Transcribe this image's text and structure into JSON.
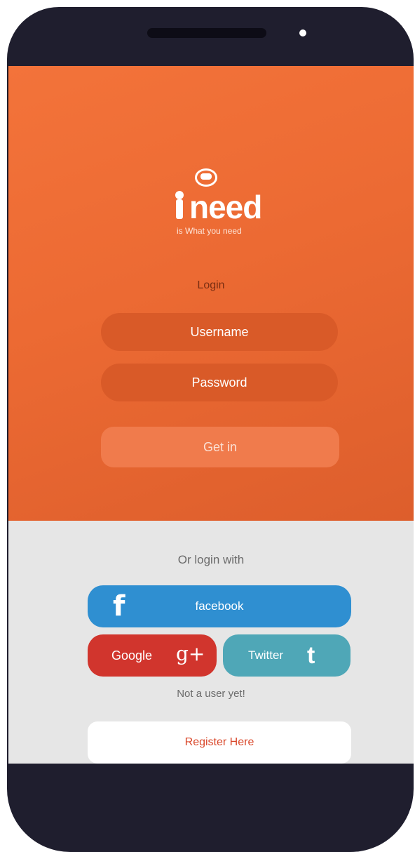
{
  "app": {
    "logo_text": "need",
    "tagline": "is What you need"
  },
  "login": {
    "title": "Login",
    "username_placeholder": "Username",
    "password_placeholder": "Password",
    "submit_label": "Get in"
  },
  "social": {
    "heading": "Or login with",
    "facebook_label": "facebook",
    "google_label": "Google",
    "twitter_label": "Twitter",
    "facebook_icon": "f",
    "google_icon": "g+",
    "twitter_icon": "t"
  },
  "register": {
    "prompt": "Not a user yet!",
    "button_label": "Register Here"
  },
  "colors": {
    "orange_bg": "#ec6a33",
    "facebook": "#2f8fd1",
    "google": "#d1352d",
    "twitter": "#4fa7b7",
    "register_text": "#d9472a"
  }
}
